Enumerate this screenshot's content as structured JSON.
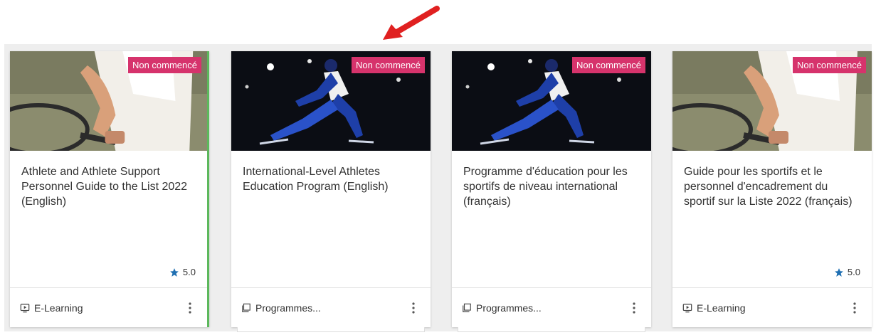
{
  "colors": {
    "badge": "#d6336c",
    "star": "#1f6fb2",
    "arrow": "#e02020",
    "accent": "#5cb85c"
  },
  "cards": [
    {
      "status": "Non commencé",
      "title": "Athlete and Athlete Support Personnel Guide to the List 2022 (English)",
      "rating": "5.0",
      "type": "E-Learning",
      "type_icon": "monitor-play-icon",
      "image": "tennis-player"
    },
    {
      "status": "Non commencé",
      "title": "International-Level Athletes Education Program (English)",
      "rating": "",
      "type": "Programmes...",
      "type_icon": "stacked-pages-icon",
      "image": "speed-skater"
    },
    {
      "status": "Non commencé",
      "title": "Programme d'éducation pour les sportifs de niveau international (français)",
      "rating": "",
      "type": "Programmes...",
      "type_icon": "stacked-pages-icon",
      "image": "speed-skater"
    },
    {
      "status": "Non commencé",
      "title": "Guide pour les sportifs et le personnel d'encadrement du sportif sur la Liste 2022 (français)",
      "rating": "5.0",
      "type": "E-Learning",
      "type_icon": "monitor-play-icon",
      "image": "tennis-player"
    }
  ]
}
